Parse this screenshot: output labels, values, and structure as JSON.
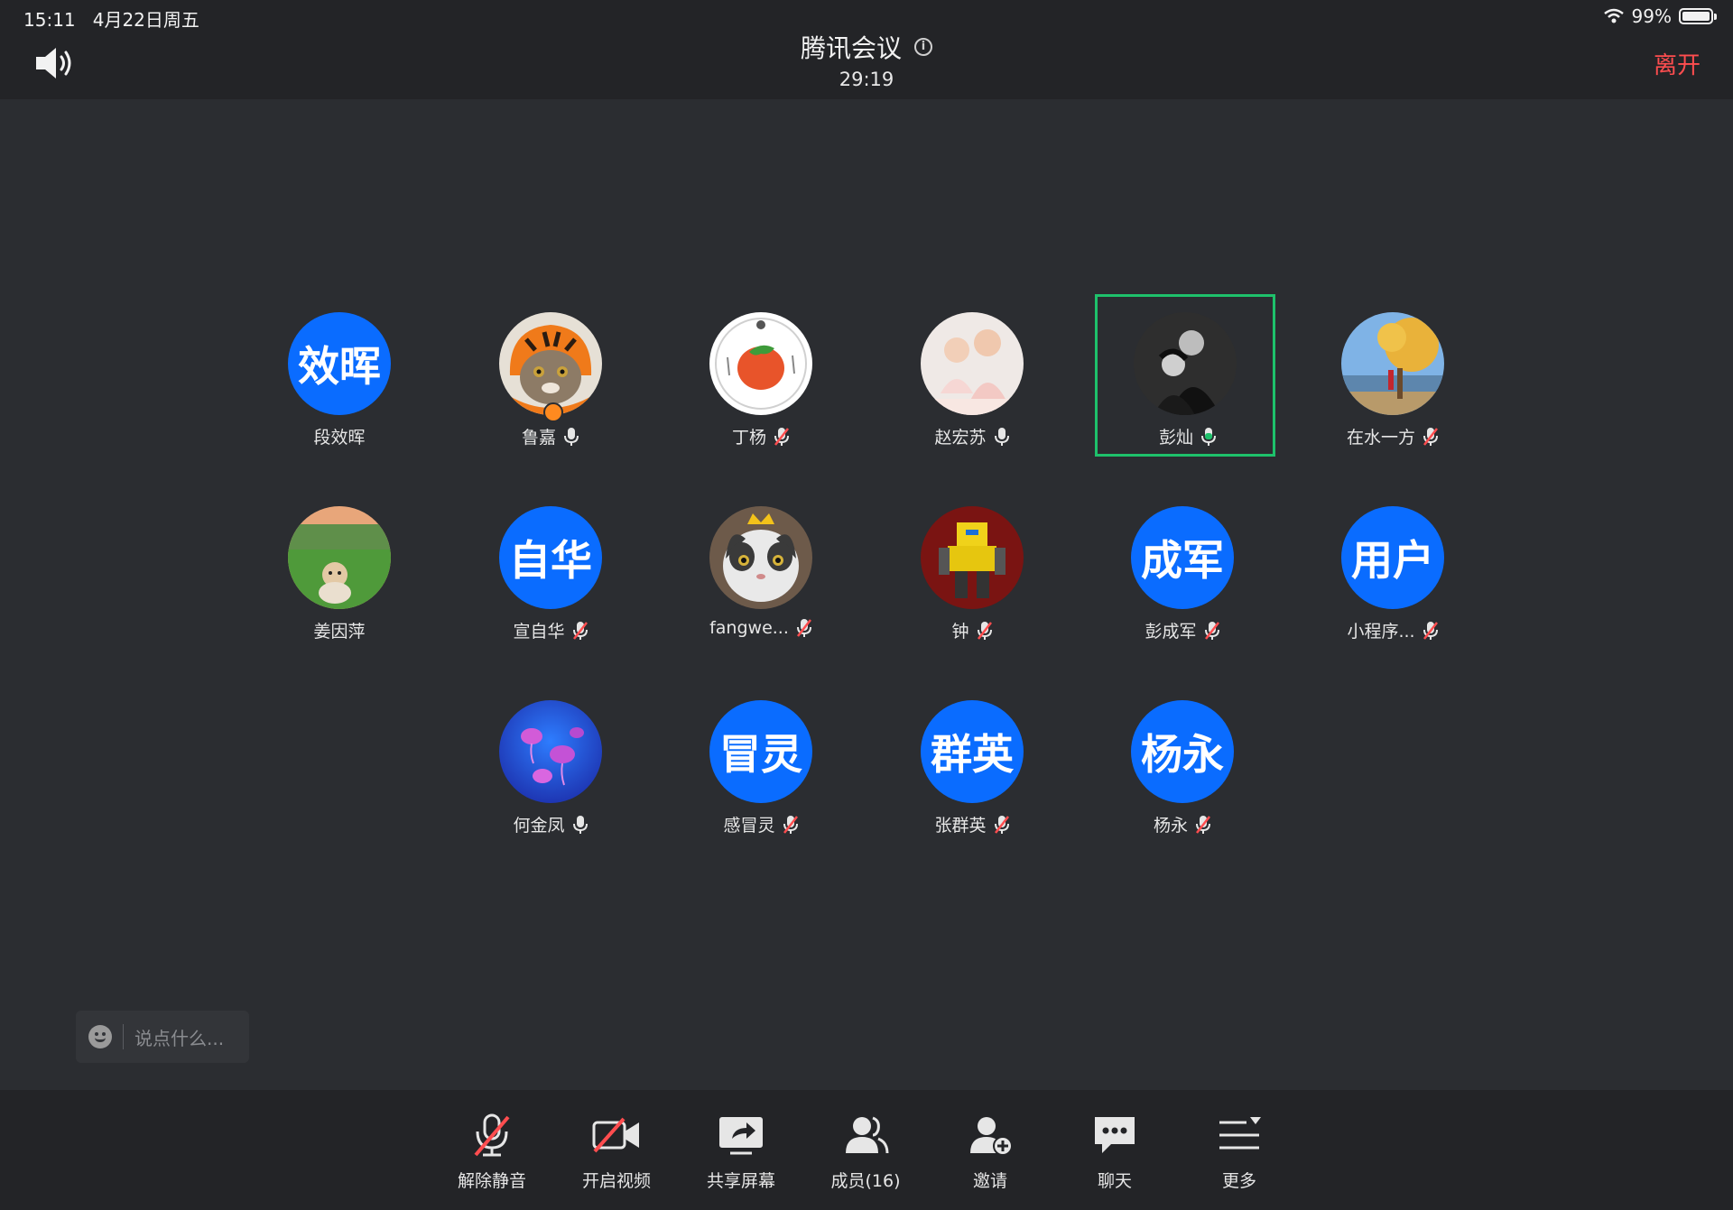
{
  "status_bar": {
    "time": "15:11",
    "date": "4月22日周五",
    "battery": "99%"
  },
  "header": {
    "title": "腾讯会议",
    "duration": "29:19",
    "leave": "离开"
  },
  "participants": [
    {
      "name": "段效晖",
      "avatar_text": "效晖",
      "mic": "none"
    },
    {
      "name": "鲁嘉",
      "mic": "on",
      "avatar_icon": "tiger-hat-cat"
    },
    {
      "name": "丁杨",
      "mic": "muted",
      "avatar_icon": "tomato-logo"
    },
    {
      "name": "赵宏苏",
      "mic": "on",
      "avatar_icon": "kids-photo"
    },
    {
      "name": "彭灿",
      "mic": "speaking",
      "avatar_icon": "couple-photo"
    },
    {
      "name": "在水一方",
      "mic": "muted",
      "avatar_icon": "autumn-tree-photo"
    },
    {
      "name": "姜因萍",
      "mic": "none",
      "avatar_icon": "dog-on-grass-photo"
    },
    {
      "name": "宣自华",
      "avatar_text": "自华",
      "mic": "muted"
    },
    {
      "name": "fangwe...",
      "mic": "muted",
      "avatar_icon": "cat-with-crown"
    },
    {
      "name": "钟",
      "mic": "muted",
      "avatar_icon": "robot-toy-photo"
    },
    {
      "name": "彭成军",
      "avatar_text": "成军",
      "mic": "muted"
    },
    {
      "name": "小程序...",
      "avatar_text": "用户",
      "mic": "muted"
    },
    {
      "name": "何金凤",
      "mic": "on",
      "avatar_icon": "jellyfish-photo"
    },
    {
      "name": "感冒灵",
      "avatar_text": "冒灵",
      "mic": "muted"
    },
    {
      "name": "张群英",
      "avatar_text": "群英",
      "mic": "muted"
    },
    {
      "name": "杨永",
      "avatar_text": "杨永",
      "mic": "muted"
    }
  ],
  "chat": {
    "placeholder": "说点什么..."
  },
  "toolbar": {
    "unmute": "解除静音",
    "start_video": "开启视频",
    "share_screen": "共享屏幕",
    "members": "成员(16)",
    "invite": "邀请",
    "chat": "聊天",
    "more": "更多"
  },
  "colors": {
    "accent_blue": "#0a6cff",
    "leave_red": "#ff4d4f",
    "speaking_green": "#1ec16b",
    "muted_red": "#ff4d4f"
  }
}
